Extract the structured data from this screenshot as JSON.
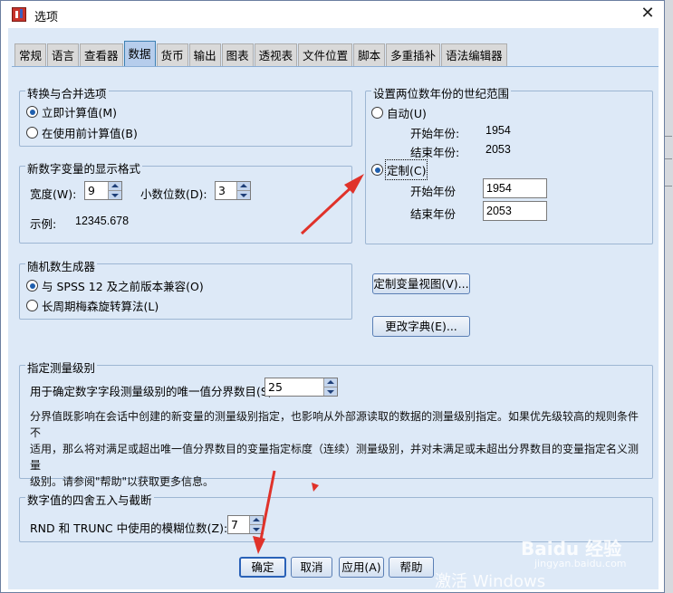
{
  "window": {
    "title": "选项"
  },
  "tabs": [
    {
      "label": "常规"
    },
    {
      "label": "语言"
    },
    {
      "label": "查看器"
    },
    {
      "label": "数据"
    },
    {
      "label": "货币"
    },
    {
      "label": "输出"
    },
    {
      "label": "图表"
    },
    {
      "label": "透视表"
    },
    {
      "label": "文件位置"
    },
    {
      "label": "脚本"
    },
    {
      "label": "多重插补"
    },
    {
      "label": "语法编辑器"
    }
  ],
  "active_tab": "数据",
  "transform": {
    "legend": "转换与合并选项",
    "opt1": "立即计算值(M)",
    "opt2": "在使用前计算值(B)"
  },
  "numeric_display": {
    "legend": "新数字变量的显示格式",
    "width_label": "宽度(W):",
    "width_value": "9",
    "decimals_label": "小数位数(D):",
    "decimals_value": "3",
    "example_label": "示例:",
    "example_value": "12345.678"
  },
  "random": {
    "legend": "随机数生成器",
    "opt1": "与 SPSS 12 及之前版本兼容(O)",
    "opt2": "长周期梅森旋转算法(L)"
  },
  "century": {
    "legend": "设置两位数年份的世纪范围",
    "auto_label": "自动(U)",
    "auto_begin_label": "开始年份:",
    "auto_begin_value": "1954",
    "auto_end_label": "结束年份:",
    "auto_end_value": "2053",
    "custom_label": "定制(C)",
    "custom_begin_label": "开始年份",
    "custom_begin_value": "1954",
    "custom_end_label": "结束年份",
    "custom_end_value": "2053"
  },
  "buttons_right": {
    "custom_view": "定制变量视图(V)...",
    "change_dict": "更改字典(E)..."
  },
  "measurement": {
    "legend": "指定测量级别",
    "label": "用于确定数字字段测量级别的唯一值分界数目(S)",
    "value": "25",
    "desc_line1": "分界值既影响在会话中创建的新变量的测量级别指定，也影响从外部源读取的数据的测量级别指定。如果优先级较高的规则条件不",
    "desc_line2": "适用，那么将对满足或超出唯一值分界数目的变量指定标度（连续）测量级别，并对未满足或未超出分界数目的变量指定名义测量",
    "desc_line3": "级别。请参阅\"帮助\"以获取更多信息。"
  },
  "rounding": {
    "legend": "数字值的四舍五入与截断",
    "label": "RND 和 TRUNC 中使用的模糊位数(Z):",
    "value": "7"
  },
  "footer": {
    "ok": "确定",
    "cancel": "取消",
    "apply": "应用(A)",
    "help": "帮助"
  },
  "watermark": {
    "text1": "激活 Windows",
    "text2": "Baidu 经验",
    "text3": "jingyan.baidu.com"
  },
  "colors": {
    "accent": "#2a62b8",
    "annotation_arrow": "#e0322a",
    "panel_bg": "#dde9f7"
  }
}
